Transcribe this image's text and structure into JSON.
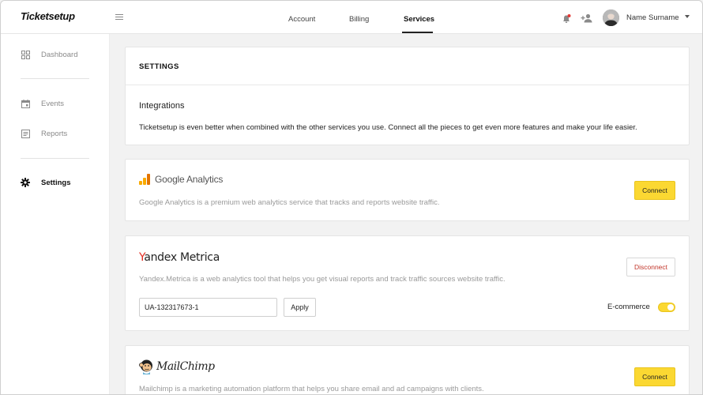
{
  "app": {
    "logo": "Ticketsetup"
  },
  "header": {
    "tabs": [
      {
        "label": "Account"
      },
      {
        "label": "Billing"
      },
      {
        "label": "Services"
      }
    ],
    "user_name": "Name Surname"
  },
  "sidebar": {
    "items": [
      {
        "label": "Dashboard",
        "icon": "grid-icon"
      },
      {
        "label": "Events",
        "icon": "calendar-icon"
      },
      {
        "label": "Reports",
        "icon": "document-icon"
      },
      {
        "label": "Settings",
        "icon": "gear-icon"
      }
    ]
  },
  "settings": {
    "title": "SETTINGS",
    "integrations_title": "Integrations",
    "integrations_desc": "Ticketsetup is even better when combined with the other services you use. Connect all the pieces to get even more features and make your life easier."
  },
  "services": {
    "google": {
      "name": "Google Analytics",
      "desc": "Google Analytics is a premium web analytics service that tracks and reports website traffic.",
      "button": "Connect"
    },
    "yandex": {
      "name_first": "Y",
      "name_rest": "andex Metrica",
      "desc": "Yandex.Metrica is a web analytics tool that helps you get visual reports and track traffic sources website traffic.",
      "button": "Disconnect",
      "input_value": "UA-132317673-1",
      "apply": "Apply",
      "ecommerce_label": "E-commerce",
      "ecommerce_on": true
    },
    "mailchimp": {
      "name": "MailChimp",
      "desc": "Mailchimp is a marketing automation platform that helps you share email and ad campaigns with clients.",
      "button": "Connect"
    }
  },
  "colors": {
    "accent": "#fbd832",
    "danger": "#c2362b",
    "notification": "#e53935"
  }
}
